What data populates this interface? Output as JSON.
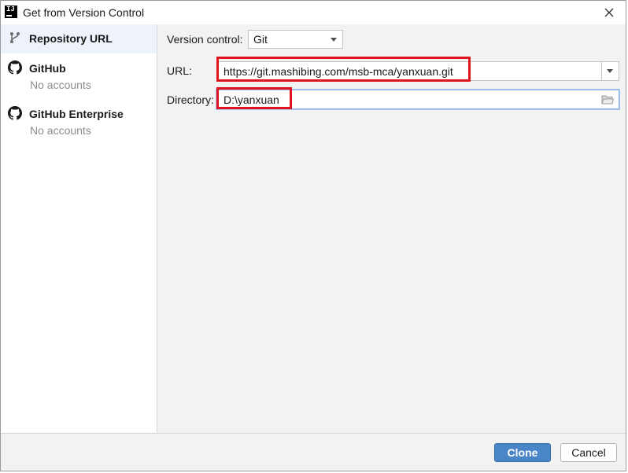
{
  "window": {
    "title": "Get from Version Control",
    "app_icon_text": "IJ"
  },
  "sidebar": {
    "items": [
      {
        "label": "Repository URL",
        "sub": "",
        "icon": "vcs-branch-icon",
        "selected": true
      },
      {
        "label": "GitHub",
        "sub": "No accounts",
        "icon": "github-icon",
        "selected": false
      },
      {
        "label": "GitHub Enterprise",
        "sub": "No accounts",
        "icon": "github-icon",
        "selected": false
      }
    ]
  },
  "form": {
    "vcs_label": "Version control:",
    "vcs_value": "Git",
    "url_label": "URL:",
    "url_value": "https://git.mashibing.com/msb-mca/yanxuan.git",
    "directory_label": "Directory:",
    "directory_value": "D:\\yanxuan"
  },
  "footer": {
    "clone_label": "Clone",
    "cancel_label": "Cancel"
  },
  "colors": {
    "primary_button": "#4a86c7",
    "highlight_box": "#e0141e",
    "selected_row": "#edf2fb",
    "focus_border": "#8db3e6"
  }
}
